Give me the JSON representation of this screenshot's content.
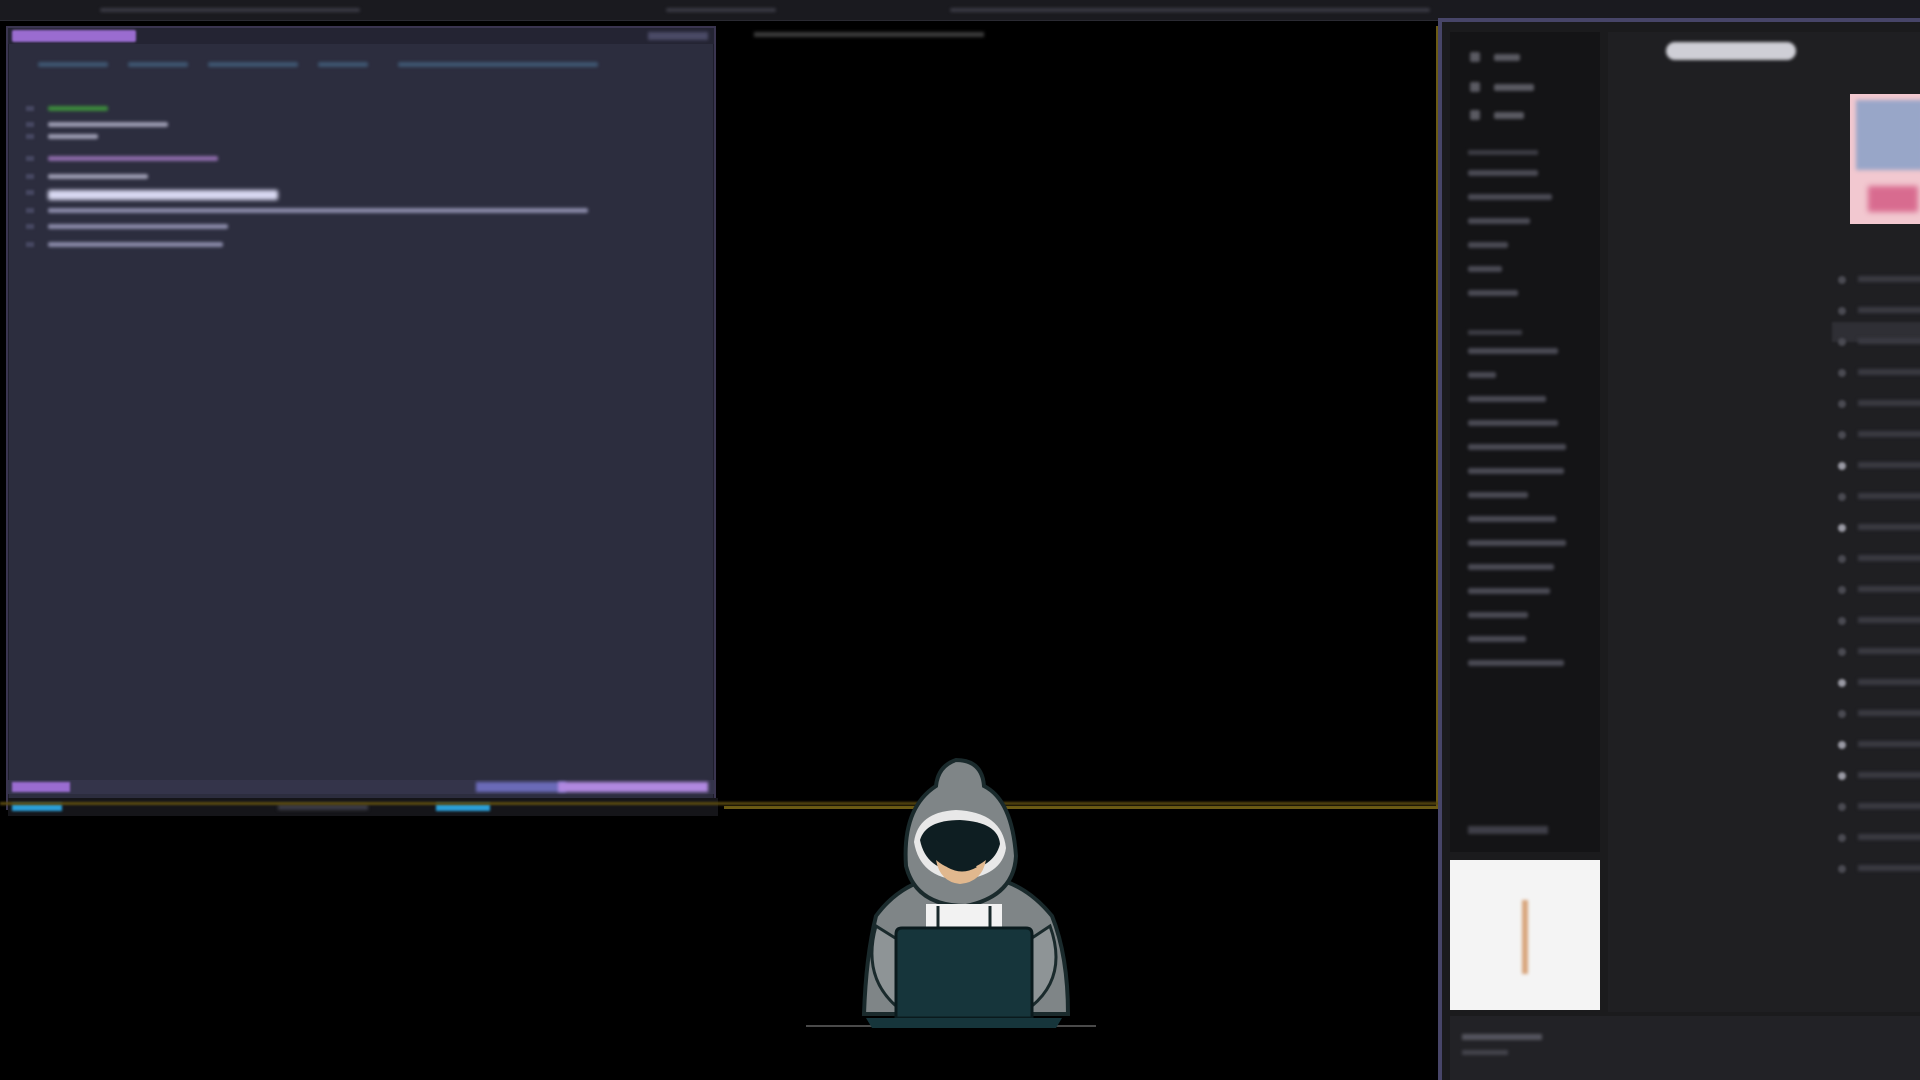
{
  "editor": {
    "code_lines": [
      {
        "color": "#3c8a3c",
        "width": 60
      },
      {
        "color": "#9a9ab0",
        "width": 120
      },
      {
        "color": "#9a9ab0",
        "width": 50
      },
      {
        "color": "#8c6aa8",
        "width": 170
      },
      {
        "color": "#9a9ab0",
        "width": 100
      },
      {
        "color": "#e0e0f0",
        "width": 230,
        "highlight": true
      },
      {
        "color": "#8888a6",
        "width": 540
      },
      {
        "color": "#8888a6",
        "width": 180
      },
      {
        "color": "#8888a6",
        "width": 175
      }
    ]
  },
  "browser": {
    "sidebar_nav_count": 3,
    "library_items": 6,
    "playlist_items": 14,
    "tracklist_rows": 20,
    "lit_rows": [
      6,
      8,
      13,
      15,
      16
    ]
  },
  "colors": {
    "editor_bg": "#2c2d3e",
    "accent_purple": "#9a6cd0",
    "accent_blue": "#2a9ed8",
    "frame_yellow": "#6b5a14",
    "browser_bg": "#1b1b1d"
  }
}
